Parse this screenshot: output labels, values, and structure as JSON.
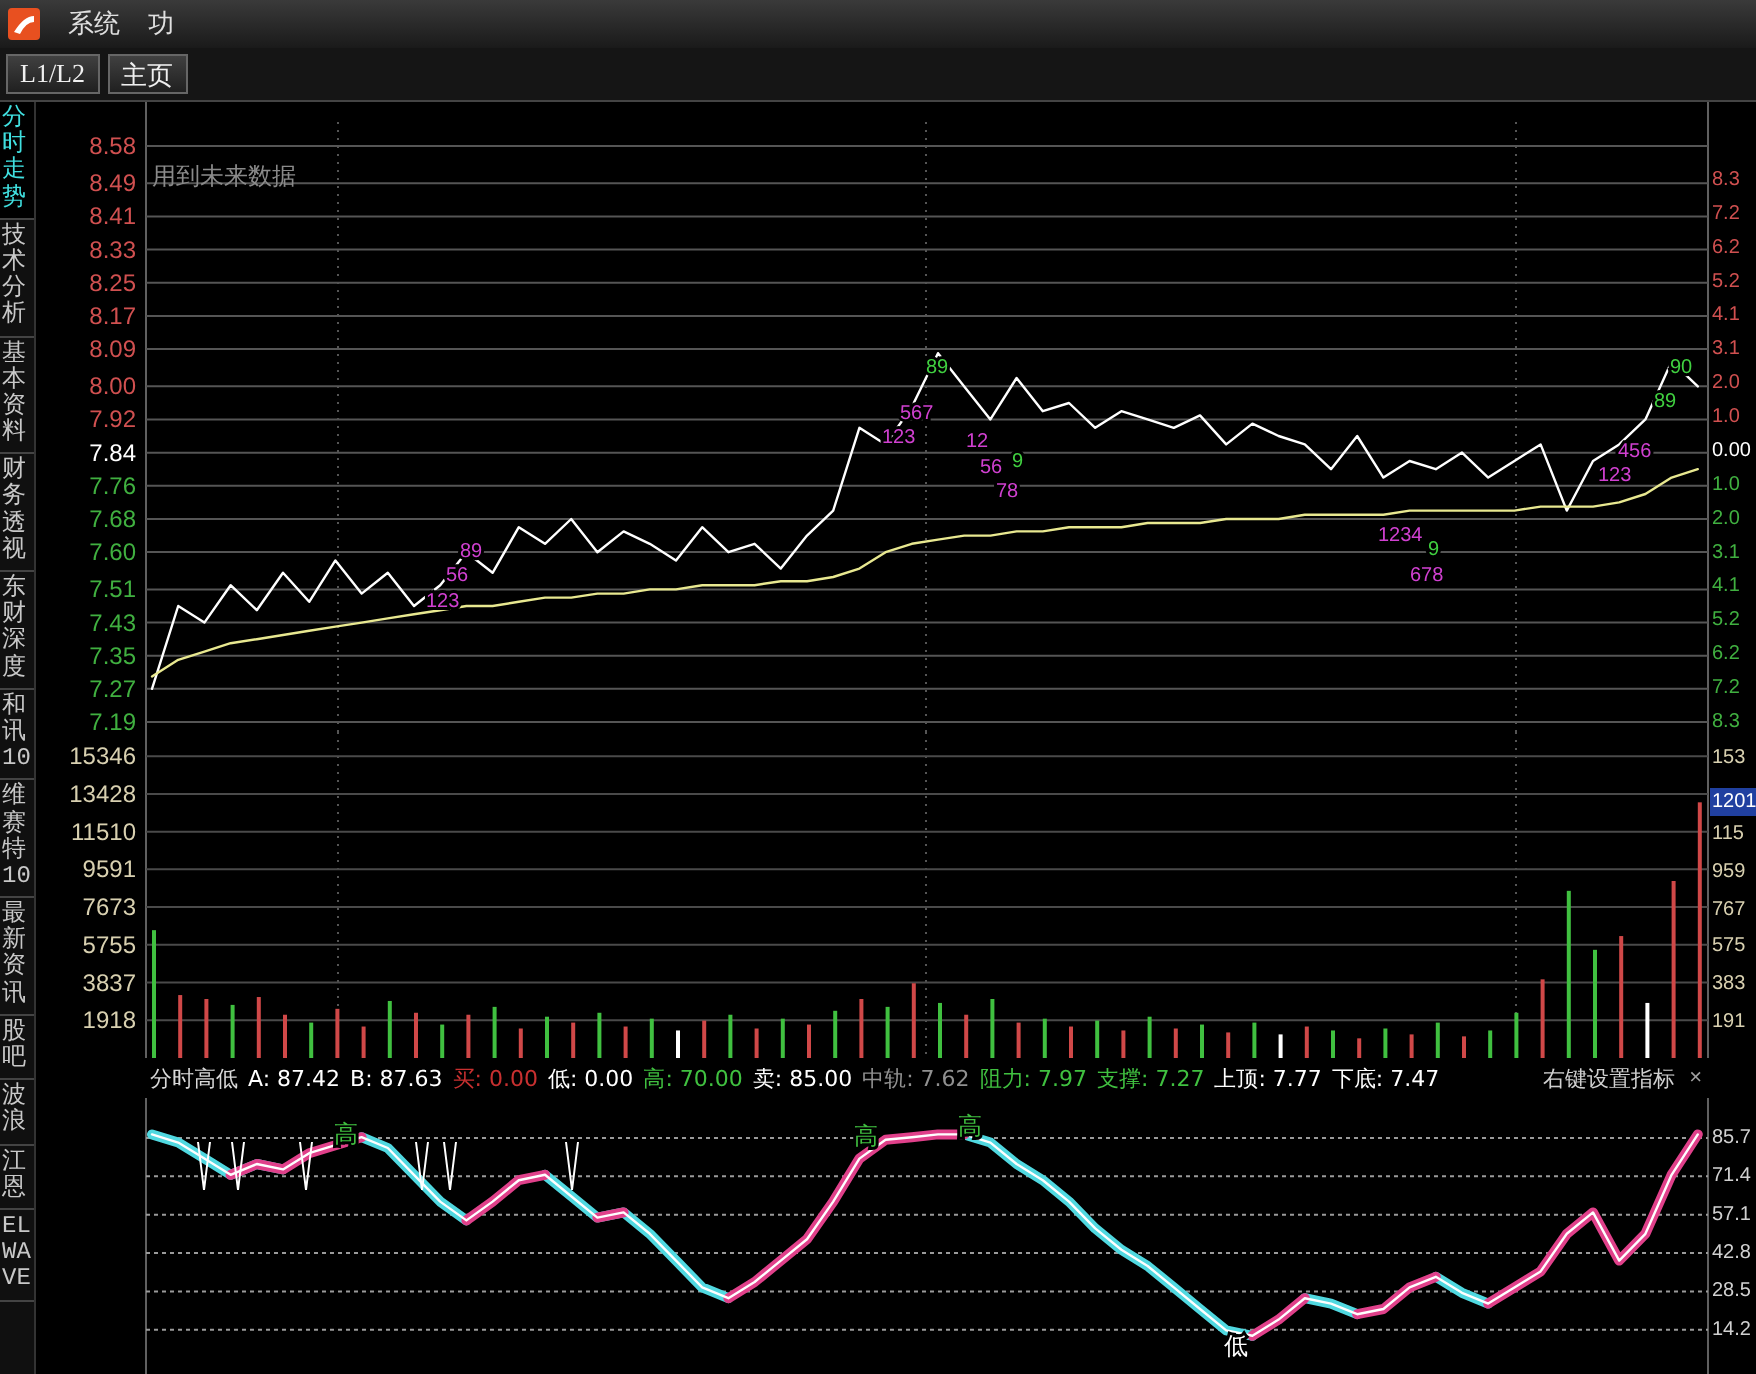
{
  "menu_bar": {
    "items": [
      "系统",
      "功"
    ]
  },
  "toolbar": {
    "buttons": [
      "L1/L2",
      "主页"
    ]
  },
  "sidebar": {
    "tabs": [
      {
        "label": "分时走势",
        "selected": true
      },
      {
        "label": "技术分析",
        "selected": false
      },
      {
        "label": "基本资料",
        "selected": false
      },
      {
        "label": "财务透视",
        "selected": false
      },
      {
        "label": "东财深度",
        "selected": false
      },
      {
        "label": "和讯10",
        "selected": false
      },
      {
        "label": "维赛特10",
        "selected": false
      },
      {
        "label": "最新资讯",
        "selected": false
      },
      {
        "label": "股吧",
        "selected": false
      },
      {
        "label": "波浪",
        "selected": false
      },
      {
        "label": "江恩",
        "selected": false
      },
      {
        "label": "ELWAVE",
        "selected": false
      }
    ]
  },
  "price_panel": {
    "note": "用到未来数据",
    "right_axis_labels": [
      "8.3",
      "7.2",
      "6.2",
      "5.2",
      "4.1",
      "3.1",
      "2.0",
      "1.0",
      "0.00",
      "1.0",
      "2.0",
      "3.1",
      "4.1",
      "5.2",
      "6.2",
      "7.2",
      "8.3"
    ],
    "markers": [
      {
        "text": "123",
        "color": "#d040d0"
      },
      {
        "text": "56",
        "color": "#d040d0"
      },
      {
        "text": "89",
        "color": "#d040d0"
      },
      {
        "text": "123",
        "color": "#d040d0"
      },
      {
        "text": "567",
        "color": "#d040d0"
      },
      {
        "text": "89",
        "color": "#40d040"
      },
      {
        "text": "12",
        "color": "#d040d0"
      },
      {
        "text": "56",
        "color": "#d040d0"
      },
      {
        "text": "78",
        "color": "#d040d0"
      },
      {
        "text": "9",
        "color": "#40d040"
      },
      {
        "text": "1234",
        "color": "#d040d0"
      },
      {
        "text": "9",
        "color": "#40d040"
      },
      {
        "text": "678",
        "color": "#d040d0"
      },
      {
        "text": "123",
        "color": "#d040d0"
      },
      {
        "text": "456",
        "color": "#d040d0"
      },
      {
        "text": "89",
        "color": "#40d040"
      },
      {
        "text": "90",
        "color": "#40d040"
      }
    ],
    "chart_data": {
      "type": "line",
      "grid": true,
      "ylim": [
        7.19,
        8.58
      ],
      "yticks": [
        8.58,
        8.49,
        8.41,
        8.33,
        8.25,
        8.17,
        8.09,
        {
          "value": 8,
          "label": "8.00"
        },
        7.92,
        7.84,
        7.76,
        7.68,
        {
          "value": 7.6,
          "label": "7.60"
        },
        7.51,
        7.43,
        7.35,
        7.27,
        7.19
      ],
      "series": [
        {
          "color": "#ffffff",
          "values": [
            7.27,
            7.47,
            7.43,
            7.52,
            7.46,
            7.55,
            7.48,
            7.58,
            7.5,
            7.55,
            7.47,
            7.52,
            7.6,
            7.55,
            7.66,
            7.62,
            7.68,
            7.6,
            7.65,
            7.62,
            7.58,
            7.66,
            7.6,
            7.62,
            7.56,
            7.64,
            7.7,
            7.9,
            7.86,
            7.95,
            8.08,
            8.0,
            7.92,
            8.02,
            7.94,
            7.96,
            7.9,
            7.94,
            7.92,
            7.9,
            7.93,
            7.86,
            7.91,
            7.88,
            7.86,
            7.8,
            7.88,
            7.78,
            7.82,
            7.8,
            7.84,
            7.78,
            7.82,
            7.86,
            7.7,
            7.82,
            7.86,
            7.92,
            8.06,
            8.0
          ]
        },
        {
          "color": "#e8e890",
          "values": [
            7.3,
            7.34,
            7.36,
            7.38,
            7.39,
            7.4,
            7.41,
            7.42,
            7.43,
            7.44,
            7.45,
            7.46,
            7.47,
            7.47,
            7.48,
            7.49,
            7.49,
            7.5,
            7.5,
            7.51,
            7.51,
            7.52,
            7.52,
            7.52,
            7.53,
            7.53,
            7.54,
            7.56,
            7.6,
            7.62,
            7.63,
            7.64,
            7.64,
            7.65,
            7.65,
            7.66,
            7.66,
            7.66,
            7.67,
            7.67,
            7.67,
            7.68,
            7.68,
            7.68,
            7.69,
            7.69,
            7.69,
            7.69,
            7.7,
            7.7,
            7.7,
            7.7,
            7.7,
            7.71,
            7.71,
            7.71,
            7.72,
            7.74,
            7.78,
            7.8
          ]
        }
      ]
    }
  },
  "volume_panel": {
    "right_axis_labels": [
      {
        "text": "153",
        "highlighted": false
      },
      {
        "text": "1201",
        "highlighted": true
      },
      {
        "text": "115",
        "highlighted": false
      },
      {
        "text": "959",
        "highlighted": false
      },
      {
        "text": "767",
        "highlighted": false
      },
      {
        "text": "575",
        "highlighted": false
      },
      {
        "text": "383",
        "highlighted": false
      },
      {
        "text": "191",
        "highlighted": false
      }
    ],
    "chart_data": {
      "type": "bar",
      "grid": true,
      "ylim": [
        0,
        16576
      ],
      "yticks": [
        15346,
        13428,
        11510,
        9591,
        7673,
        5755,
        3837,
        1918
      ],
      "series": [
        {
          "color": "#d04848",
          "values": [
            null,
            3200,
            3000,
            null,
            3100,
            2200,
            null,
            2500,
            1600,
            null,
            2300,
            null,
            2200,
            null,
            1500,
            null,
            1800,
            null,
            1600,
            null,
            null,
            1900,
            null,
            1500,
            null,
            1700,
            null,
            3000,
            null,
            3800,
            null,
            2200,
            null,
            1800,
            null,
            1600,
            null,
            1400,
            null,
            1500,
            null,
            1300,
            null,
            null,
            1600,
            null,
            1000,
            null,
            1200,
            null,
            1100,
            null,
            null,
            4000,
            null,
            null,
            6200,
            null,
            9000,
            13000
          ]
        },
        {
          "color": "#40c040",
          "values": [
            6500,
            null,
            null,
            2700,
            null,
            null,
            1800,
            null,
            null,
            2900,
            null,
            1700,
            null,
            2600,
            null,
            2100,
            null,
            2300,
            null,
            2000,
            null,
            null,
            2200,
            null,
            2000,
            null,
            2400,
            null,
            2600,
            null,
            2800,
            null,
            3000,
            null,
            2000,
            null,
            1900,
            null,
            2100,
            null,
            1700,
            null,
            1800,
            null,
            null,
            1400,
            null,
            1500,
            null,
            1800,
            null,
            1400,
            2300,
            null,
            8500,
            5500,
            null,
            null,
            null,
            null
          ]
        },
        {
          "color": "#ffffff",
          "values": [
            null,
            null,
            null,
            null,
            null,
            null,
            null,
            null,
            null,
            null,
            null,
            null,
            null,
            null,
            null,
            null,
            null,
            null,
            null,
            null,
            1400,
            null,
            null,
            null,
            null,
            null,
            null,
            null,
            null,
            null,
            null,
            null,
            null,
            null,
            null,
            null,
            null,
            null,
            null,
            null,
            null,
            null,
            null,
            1200,
            null,
            null,
            null,
            null,
            null,
            null,
            null,
            null,
            null,
            null,
            null,
            null,
            null,
            2800,
            null,
            null
          ]
        }
      ]
    }
  },
  "indicator_panel": {
    "name": "分时高低",
    "legend": [
      {
        "text": "A: 87.42",
        "color": "#ffffff"
      },
      {
        "text": "B: 87.63",
        "color": "#ffffff"
      },
      {
        "text": "买: 0.00",
        "color": "#c83030"
      },
      {
        "text": "低: 0.00",
        "color": "#ffffff"
      },
      {
        "text": "高: 70.00",
        "color": "#40c040"
      },
      {
        "text": "卖: 85.00",
        "color": "#ffffff"
      },
      {
        "text": "中轨: 7.62",
        "color": "#909090"
      },
      {
        "text": "阻力: 7.97",
        "color": "#40c040"
      },
      {
        "text": "支撑: 7.27",
        "color": "#40c040"
      },
      {
        "text": "上顶: 7.77",
        "color": "#ffffff"
      },
      {
        "text": "下底: 7.47",
        "color": "#ffffff"
      }
    ],
    "settings_hint": "右键设置指标",
    "close": "×",
    "right_axis_labels": [
      "85.7",
      "71.4",
      "57.1",
      "42.8",
      "28.5",
      "14.2"
    ],
    "markers": [
      {
        "text": "高",
        "color": "#40c040"
      },
      {
        "text": "高",
        "color": "#40c040"
      },
      {
        "text": "高",
        "color": "#40c040"
      },
      {
        "text": "低",
        "color": "#ffffff"
      }
    ],
    "chart_data": {
      "type": "line",
      "grid": true,
      "ylim": [
        -3,
        100.6
      ],
      "yticks": [
        85.7,
        71.4,
        57.1,
        42.8,
        28.5,
        14.2
      ],
      "series": [
        {
          "color": "#50d8e0",
          "values": [
            87,
            84,
            78,
            72,
            76,
            74,
            null,
            null,
            86,
            82,
            72,
            62,
            55,
            null,
            null,
            72,
            64,
            56,
            58,
            50,
            40,
            30,
            26,
            null,
            null,
            null,
            null,
            null,
            null,
            null,
            null,
            87,
            84,
            76,
            70,
            62,
            52,
            44,
            38,
            30,
            22,
            14,
            12,
            null,
            26,
            24,
            20,
            null,
            null,
            34,
            28,
            24,
            null,
            null,
            null,
            null,
            null,
            null,
            null,
            null
          ]
        },
        {
          "color": "#e0408a",
          "values": [
            null,
            null,
            null,
            72,
            76,
            74,
            80,
            83,
            86,
            null,
            null,
            null,
            55,
            62,
            70,
            72,
            null,
            56,
            58,
            null,
            null,
            null,
            26,
            32,
            40,
            48,
            62,
            78,
            85,
            86,
            87,
            87,
            null,
            null,
            null,
            null,
            null,
            null,
            null,
            null,
            null,
            null,
            12,
            18,
            26,
            null,
            20,
            22,
            30,
            34,
            null,
            24,
            30,
            36,
            50,
            58,
            40,
            50,
            72,
            87
          ]
        },
        {
          "color": "#ffffff",
          "values": [
            87,
            84,
            78,
            72,
            76,
            74,
            80,
            83,
            86,
            82,
            72,
            62,
            55,
            62,
            70,
            72,
            64,
            56,
            58,
            50,
            40,
            30,
            26,
            32,
            40,
            48,
            62,
            78,
            85,
            86,
            87,
            87,
            84,
            76,
            70,
            62,
            52,
            44,
            38,
            30,
            22,
            14,
            12,
            18,
            26,
            24,
            20,
            22,
            30,
            34,
            28,
            24,
            30,
            36,
            50,
            58,
            40,
            50,
            72,
            87
          ]
        }
      ]
    }
  }
}
